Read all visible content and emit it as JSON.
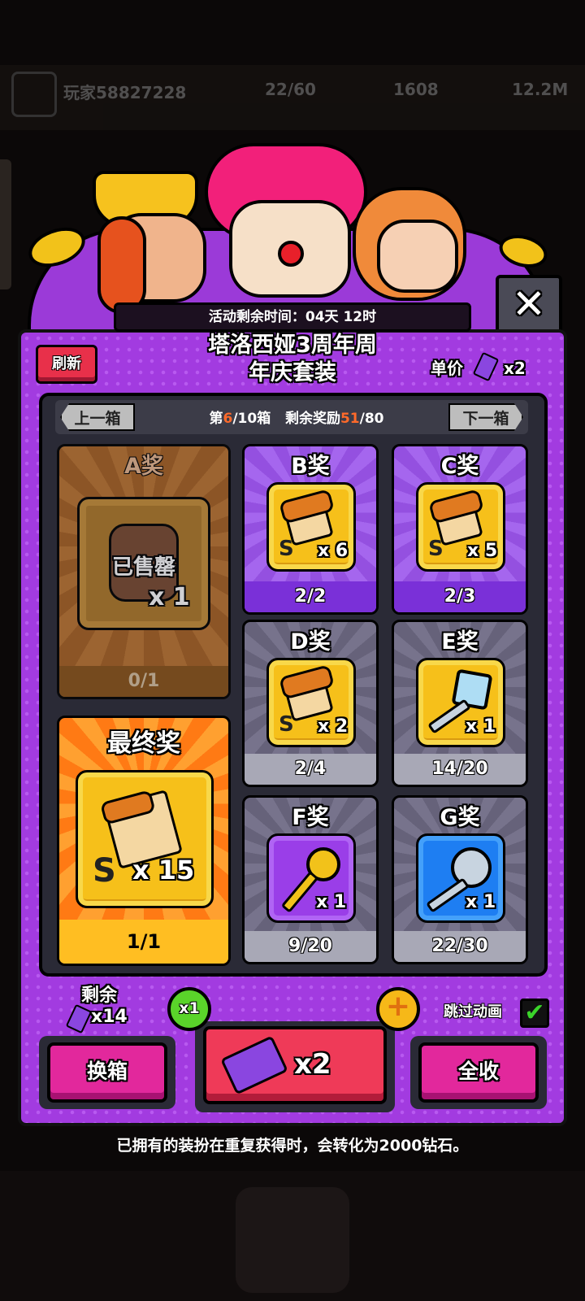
{
  "hud": {
    "player_name": "玩家58827228",
    "energy": "22/60",
    "coins": "1608",
    "gems": "12.2M"
  },
  "event": {
    "time_left": "活动剩余时间：04天 12时",
    "title_line1": "塔洛西娅3周年周",
    "title_line2": "年庆套装",
    "refresh_label": "刷新",
    "unit_price_label": "单价",
    "unit_price_value": "x2"
  },
  "nav": {
    "prev_label": "上一箱",
    "next_label": "下一箱",
    "box_prefix": "第",
    "box_current": "6",
    "box_total": "/10箱",
    "remaining_prefix": "剩余奖励",
    "remaining_current": "51",
    "remaining_total": "/80"
  },
  "prizes": {
    "a": {
      "label": "A奖",
      "status": "已售罄",
      "qty": "x 1",
      "count": "0/1"
    },
    "b": {
      "label": "B奖",
      "qty": "x 6",
      "count": "2/2"
    },
    "c": {
      "label": "C奖",
      "qty": "x 5",
      "count": "2/3"
    },
    "d": {
      "label": "D奖",
      "qty": "x 2",
      "count": "2/4"
    },
    "e": {
      "label": "E奖",
      "qty": "x 1",
      "count": "14/20"
    },
    "f": {
      "label": "F奖",
      "qty": "x 1",
      "count": "9/20"
    },
    "g": {
      "label": "G奖",
      "qty": "x 1",
      "count": "22/30"
    },
    "final": {
      "label": "最终奖",
      "qty": "x 15",
      "count": "1/1"
    }
  },
  "controls": {
    "remaining_label": "剩余",
    "remaining_tickets": "x14",
    "multiplier": "x1",
    "swap_label": "换箱",
    "draw_label": "x2",
    "collect_label": "全收",
    "skip_label": "跳过动画",
    "skip_checked": "✔",
    "close_symbol": "✕",
    "plus_symbol": "+"
  },
  "note": "已拥有的装扮在重复获得时，会转化为2000钻石。",
  "colors": {
    "panel": "#a23be0",
    "accent_red": "#ef3a58",
    "accent_pink": "#e2289c",
    "final_orange": "#ff8a1e",
    "highlight": "#ff6a2a"
  }
}
